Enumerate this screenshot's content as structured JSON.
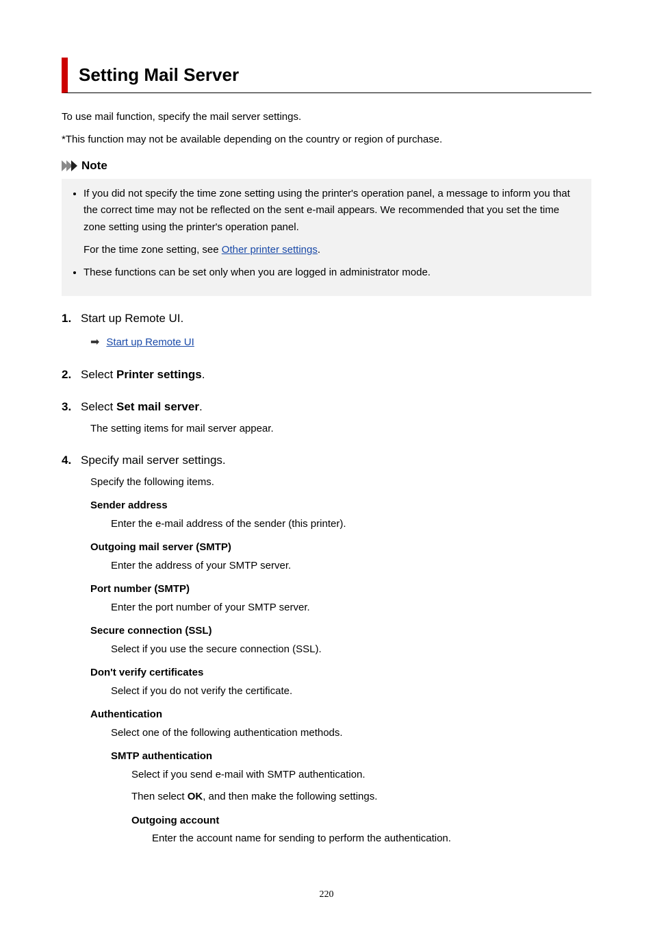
{
  "title": "Setting Mail Server",
  "intro": {
    "p1": "To use mail function, specify the mail server settings.",
    "p2": "*This function may not be available depending on the country or region of purchase."
  },
  "note": {
    "label": "Note",
    "items": [
      {
        "text": "If you did not specify the time zone setting using the printer's operation panel, a message to inform you that the correct time may not be reflected on the sent e-mail appears. We recommended that you set the time zone setting using the printer's operation panel.",
        "extra_prefix": "For the time zone setting, see ",
        "link": "Other printer settings",
        "extra_suffix": "."
      },
      {
        "text": "These functions can be set only when you are logged in administrator mode."
      }
    ]
  },
  "steps": [
    {
      "num": "1.",
      "title_plain": "Start up Remote UI.",
      "link": "Start up Remote UI"
    },
    {
      "num": "2.",
      "title_prefix": "Select ",
      "title_bold": "Printer settings",
      "title_suffix": "."
    },
    {
      "num": "3.",
      "title_prefix": "Select ",
      "title_bold": "Set mail server",
      "title_suffix": ".",
      "body": "The setting items for mail server appear."
    },
    {
      "num": "4.",
      "title_plain": "Specify mail server settings.",
      "body": "Specify the following items.",
      "defs": [
        {
          "term": "Sender address",
          "desc": "Enter the e-mail address of the sender (this printer)."
        },
        {
          "term": "Outgoing mail server (SMTP)",
          "desc": "Enter the address of your SMTP server."
        },
        {
          "term": "Port number (SMTP)",
          "desc": "Enter the port number of your SMTP server."
        },
        {
          "term": "Secure connection (SSL)",
          "desc": "Select if you use the secure connection (SSL)."
        },
        {
          "term": "Don't verify certificates",
          "desc": "Select if you do not verify the certificate."
        },
        {
          "term": "Authentication",
          "desc": "Select one of the following authentication methods.",
          "sub": {
            "term": "SMTP authentication",
            "desc": "Select if you send e-mail with SMTP authentication.",
            "cont_prefix": "Then select ",
            "cont_bold": "OK",
            "cont_suffix": ", and then make the following settings.",
            "sub2": {
              "term": "Outgoing account",
              "desc": "Enter the account name for sending to perform the authentication."
            }
          }
        }
      ]
    }
  ],
  "page_number": "220"
}
